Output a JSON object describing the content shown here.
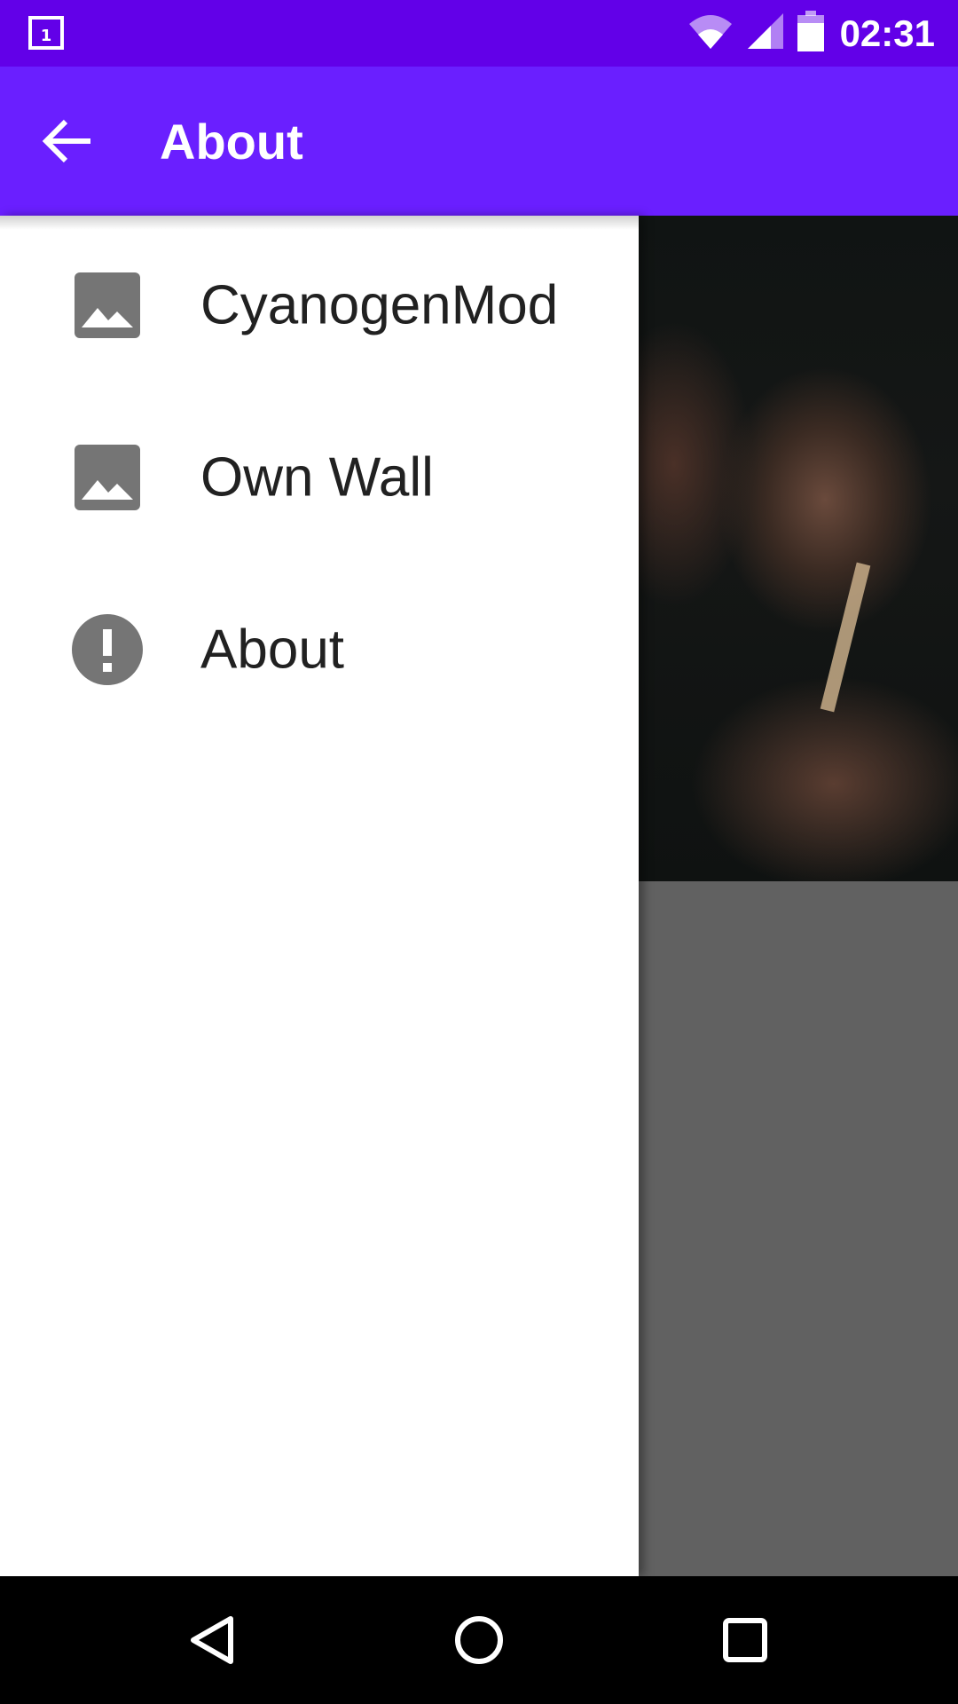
{
  "status_bar": {
    "time": "02:31",
    "notification_icon": "calendar-day-icon",
    "notification_text": "1",
    "wifi_icon": "wifi-icon",
    "signal_icon": "cell-signal-icon",
    "battery_icon": "battery-icon"
  },
  "app_bar": {
    "title": "About",
    "back_icon": "arrow-back-icon"
  },
  "drawer": {
    "items": [
      {
        "label": "CyanogenMod",
        "icon": "image-icon"
      },
      {
        "label": "Own Wall",
        "icon": "image-icon"
      },
      {
        "label": "About",
        "icon": "info-alert-icon"
      }
    ]
  },
  "nav_bar": {
    "back": "nav-back-icon",
    "home": "nav-home-icon",
    "recents": "nav-recents-icon"
  },
  "colors": {
    "status_bar": "#6200e8",
    "app_bar": "#6a1fff",
    "icon_grey": "#757575",
    "text_dark": "#212121",
    "scrim_grey": "#616161"
  }
}
